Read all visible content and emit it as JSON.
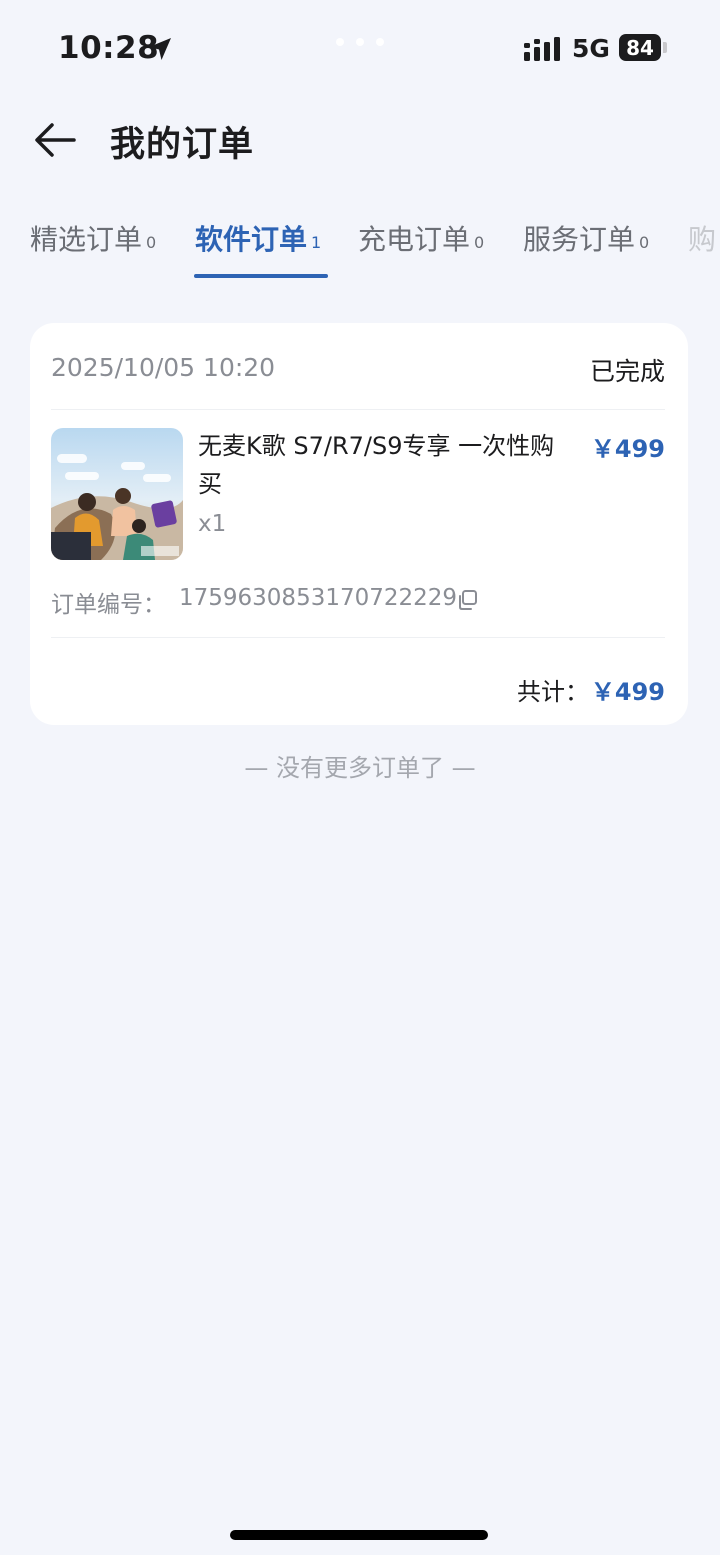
{
  "status_bar": {
    "time": "10:28",
    "network": "5G",
    "battery": "84",
    "location_icon": "location-arrow-icon",
    "signal_icon": "cellular-signal-icon"
  },
  "header": {
    "title": "我的订单",
    "back_icon": "arrow-left-icon"
  },
  "tabs": [
    {
      "label": "精选订单",
      "count": "0",
      "active": false
    },
    {
      "label": "软件订单",
      "count": "1",
      "active": true
    },
    {
      "label": "充电订单",
      "count": "0",
      "active": false
    },
    {
      "label": "服务订单",
      "count": "0",
      "active": false
    },
    {
      "label": "购",
      "count": "",
      "active": false
    }
  ],
  "order": {
    "time": "2025/10/05 10:20",
    "status": "已完成",
    "product_name": "无麦K歌 S7/R7/S9专享 一次性购买",
    "price": "￥499",
    "quantity": "x1",
    "order_no_label": "订单编号：",
    "order_no": "1759630853170722229",
    "copy_icon": "copy-icon",
    "total_label": "共计：",
    "total_value": "￥499"
  },
  "footer_text": "— 没有更多订单了 —",
  "colors": {
    "accent": "#2d63b4",
    "background": "#f3f5fb",
    "card": "#ffffff",
    "muted_text": "#8a8d94"
  }
}
